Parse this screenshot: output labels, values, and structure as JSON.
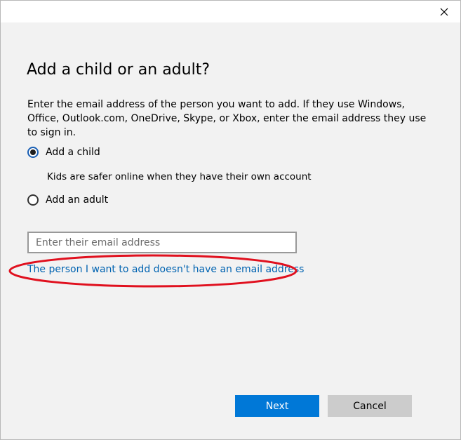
{
  "window": {
    "close_icon": "close-icon"
  },
  "heading": "Add a child or an adult?",
  "description": "Enter the email address of the person you want to add. If they use Windows, Office, Outlook.com, OneDrive, Skype, or Xbox, enter the email address they use to sign in.",
  "options": {
    "child": {
      "label": "Add a child",
      "selected": true
    },
    "child_hint": "Kids are safer online when they have their own account",
    "adult": {
      "label": "Add an adult",
      "selected": false
    }
  },
  "email": {
    "placeholder": "Enter their email address",
    "value": ""
  },
  "no_email_link": "The person I want to add doesn't have an email address",
  "buttons": {
    "next": "Next",
    "cancel": "Cancel"
  },
  "colors": {
    "accent": "#0078d7",
    "link": "#0063b1",
    "annotation": "#e0101e"
  }
}
